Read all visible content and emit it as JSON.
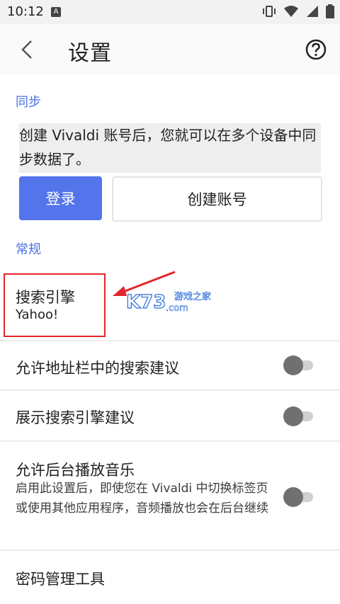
{
  "status": {
    "time": "10:12",
    "badge": "A"
  },
  "header": {
    "title": "设置"
  },
  "sync": {
    "section_title": "同步",
    "description": "创建 Vivaldi 账号后，您就可以在多个设备中同步数据了。",
    "login_label": "登录",
    "create_account_label": "创建账号"
  },
  "general": {
    "section_title": "常规",
    "search_engine": {
      "label": "搜索引擎",
      "value": "Yahoo!"
    },
    "address_bar_suggestions": {
      "label": "允许地址栏中的搜索建议",
      "enabled": false
    },
    "search_engine_suggestions": {
      "label": "展示搜索引擎建议",
      "enabled": false
    },
    "background_audio": {
      "label": "允许后台播放音乐",
      "description": "启用此设置后，即使您在 Vivaldi 中切换标签页或使用其他应用程序，音频播放也会在后台继续",
      "enabled": false
    },
    "password_manager": {
      "label": "密码管理工具"
    }
  },
  "watermark": {
    "text": "K73",
    "subtext": ".com",
    "caption": "游戏之家"
  },
  "colors": {
    "accent": "#5474ec",
    "section": "#4a6fe5",
    "highlight": "#e5252a"
  }
}
